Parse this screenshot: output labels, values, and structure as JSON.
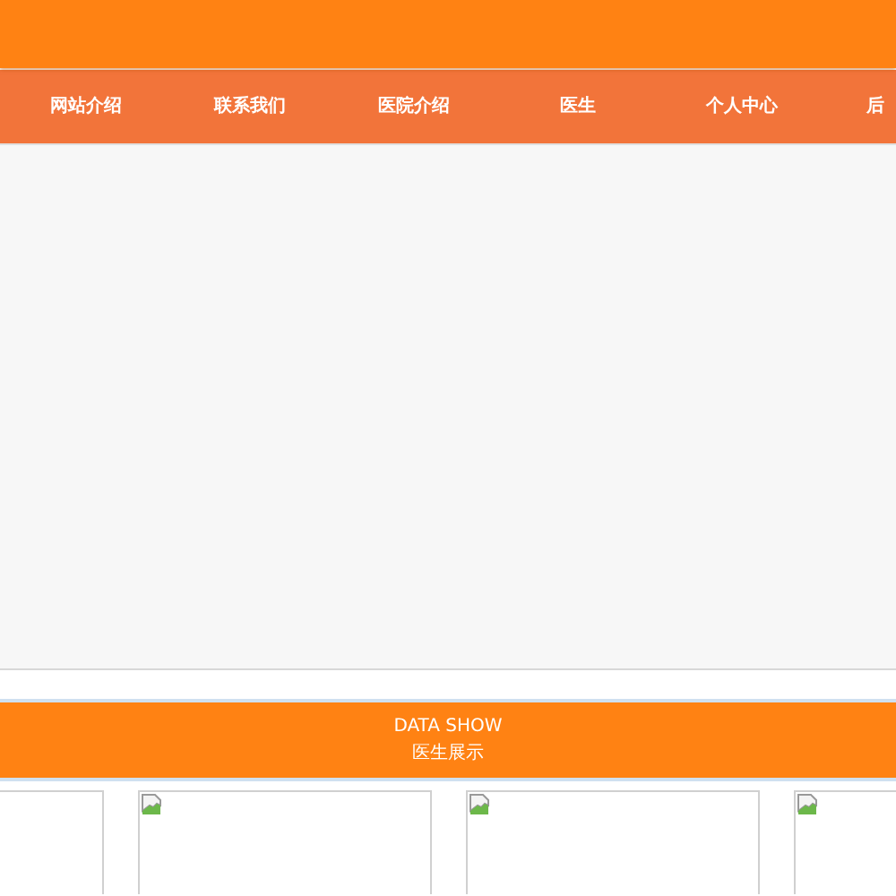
{
  "nav": {
    "items": [
      {
        "label": "网站介绍",
        "selected": false
      },
      {
        "label": "联系我们",
        "selected": false
      },
      {
        "label": "医院介绍",
        "selected": false
      },
      {
        "label": "医生",
        "selected": false
      },
      {
        "label": "个人中心",
        "selected": false
      },
      {
        "label": "后",
        "selected": false
      }
    ]
  },
  "banner": {
    "title": "DATA SHOW",
    "subtitle": "医生展示"
  },
  "cards": [
    {
      "kind": "cut"
    },
    {
      "kind": "broken_image"
    },
    {
      "kind": "broken_image"
    },
    {
      "kind": "broken_image"
    }
  ]
}
